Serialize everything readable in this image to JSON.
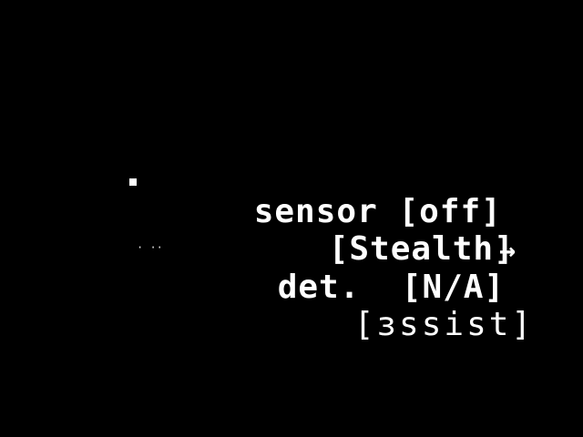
{
  "menu": {
    "sensor": {
      "label": "sensor",
      "value": "[off]"
    },
    "mode": {
      "value": "[Stealth]"
    },
    "detection": {
      "noise": "· ··",
      "label": "det.",
      "value": "[N/A]",
      "arrow": "→"
    },
    "assist": {
      "value": "[зѕѕist]"
    }
  },
  "icons": {
    "bullet": "dot-icon",
    "next": "arrow-right-icon"
  },
  "colors": {
    "background": "#000000",
    "text": "#ffffff"
  }
}
